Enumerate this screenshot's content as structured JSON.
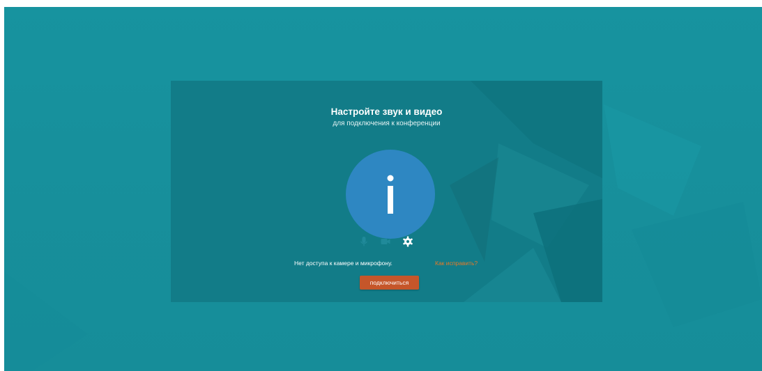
{
  "dialog": {
    "title": "Настройте звук и видео",
    "subtitle": "для подключения к конференции"
  },
  "avatar": {
    "icon": "info-icon",
    "color": "#2e87c2"
  },
  "controls": {
    "microphone": {
      "icon": "microphone-icon",
      "state": "disabled"
    },
    "camera": {
      "icon": "camera-icon",
      "state": "disabled"
    },
    "settings": {
      "icon": "gear-icon",
      "state": "enabled"
    }
  },
  "status": {
    "message": "Нет доступа к камере и микрофону.",
    "fix_link": "Как исправить?"
  },
  "connect_button": {
    "label": "подключиться"
  },
  "colors": {
    "background": "#17939f",
    "dialog": "#127c88",
    "accent_button": "#c5562a",
    "link": "#e67a27"
  }
}
